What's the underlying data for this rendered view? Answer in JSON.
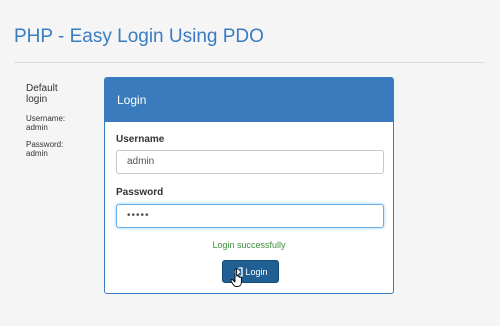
{
  "header": {
    "title": "PHP - Easy Login Using PDO"
  },
  "sidebar": {
    "heading_line1": "Default",
    "heading_line2": "login",
    "username_label": "Username:",
    "username_value": "admin",
    "password_label": "Password:",
    "password_value": "admin"
  },
  "panel": {
    "title": "Login",
    "username_label": "Username",
    "username_value": "admin",
    "password_label": "Password",
    "password_value": "•••••",
    "status_message": "Login successfully",
    "login_button_label": "Login"
  },
  "colors": {
    "accent": "#3a7bbd",
    "title": "#3a7cc1",
    "button": "#1f5f93",
    "success": "#3c8f3c",
    "focus_border": "#66afe9"
  },
  "icons": {
    "login_button_icon": "log-in-icon",
    "cursor": "hand-pointer-cursor"
  }
}
